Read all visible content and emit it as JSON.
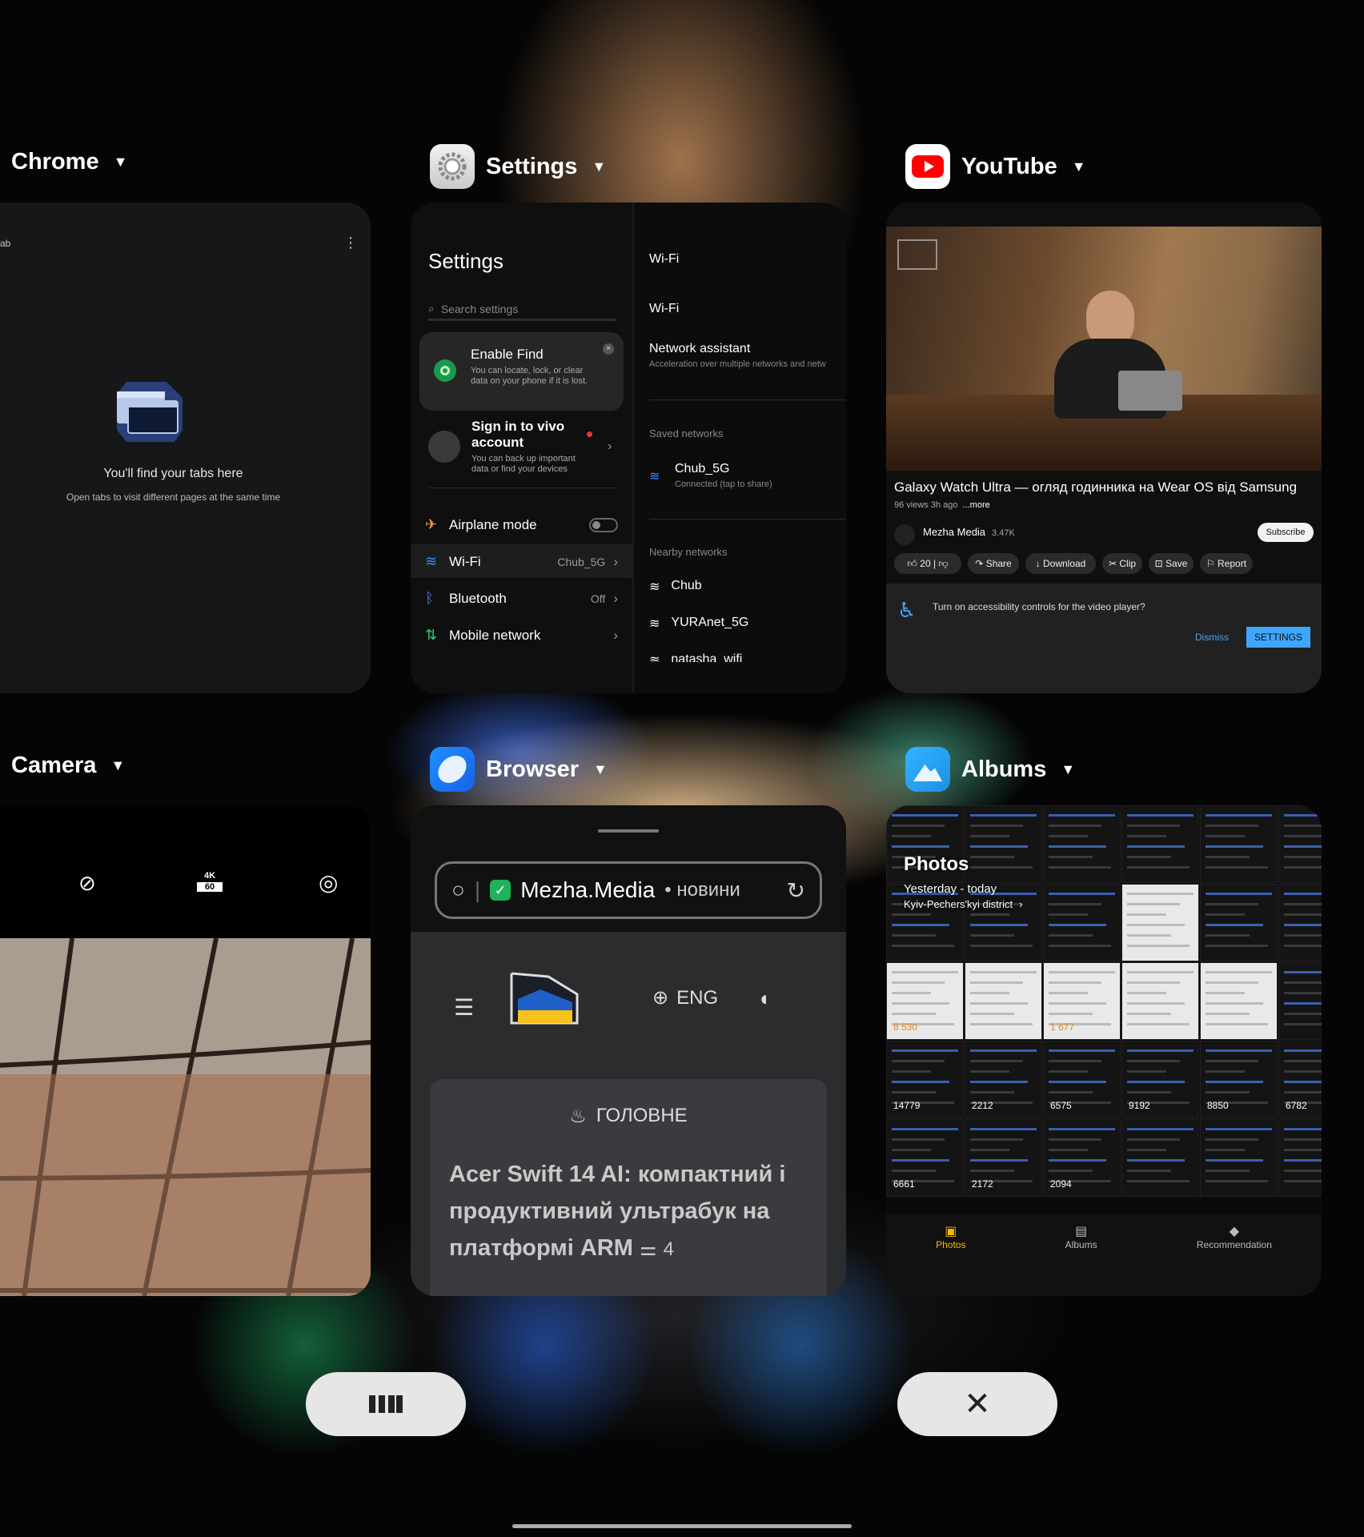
{
  "apps": {
    "chrome": {
      "label": "Chrome",
      "tab_text": "ab",
      "empty_title": "You'll find your tabs here",
      "empty_sub": "Open tabs to visit different pages at the same time"
    },
    "settings": {
      "label": "Settings",
      "title": "Settings",
      "search_placeholder": "Search settings",
      "find_title": "Enable Find",
      "find_sub": "You can locate, lock, or clear data on your phone if it is lost.",
      "signin_title": "Sign in to vivo account",
      "signin_sub": "You can back up important data or find your devices",
      "rows": [
        {
          "label": "Airplane mode",
          "value": ""
        },
        {
          "label": "Wi-Fi",
          "value": "Chub_5G"
        },
        {
          "label": "Bluetooth",
          "value": "Off"
        },
        {
          "label": "Mobile network",
          "value": ""
        }
      ],
      "wifi_header": "Wi-Fi",
      "wifi_toggle": "Wi-Fi",
      "assistant_title": "Network assistant",
      "assistant_sub": "Acceleration over multiple networks and netw",
      "saved_header": "Saved networks",
      "saved_name": "Chub_5G",
      "saved_status": "Connected (tap to share)",
      "nearby_header": "Nearby networks",
      "nearby": [
        "Chub",
        "YURAnet_5G",
        "natasha_wifi"
      ]
    },
    "youtube": {
      "label": "YouTube",
      "video_title": "Galaxy Watch Ultra — огляд годинника на Wear OS від Samsung",
      "views": "96 views  3h ago",
      "more": "...more",
      "channel": "Mezha Media",
      "subs": "3.47K",
      "subscribe": "Subscribe",
      "likes": "20",
      "share": "Share",
      "download": "Download",
      "clip": "Clip",
      "save": "Save",
      "report": "Report",
      "banner_text": "Turn on accessibility controls for the video player?",
      "dismiss": "Dismiss",
      "settings_btn": "SETTINGS"
    },
    "camera": {
      "label": "Camera",
      "res_top": "4K",
      "res_bottom": "60"
    },
    "browser": {
      "label": "Browser",
      "url_site": "Mezha.Media",
      "url_rest": "• новини",
      "lang": "ENG",
      "section": "ГОЛОВНЕ",
      "headline": "Acer Swift 14 AI: компактний і продуктивний ультрабук на платформі ARM",
      "comments": "4"
    },
    "albums": {
      "label": "Albums",
      "title": "Photos",
      "range": "Yesterday - today",
      "location": "Kyiv-Pechers'kyi district",
      "tabs": [
        {
          "label": "Photos",
          "active": true
        },
        {
          "label": "Albums",
          "active": false
        },
        {
          "label": "Recommendation",
          "active": false
        }
      ],
      "scores": [
        "8 530",
        "1 677",
        "14779",
        "2212",
        "6575",
        "9192",
        "8850",
        "6782",
        "6661",
        "2172",
        "2094"
      ]
    }
  },
  "colors": {
    "accent_blue": "#3ea6ff",
    "settings_dark": "#0c0c0c",
    "albums_accent": "#f5b800"
  }
}
